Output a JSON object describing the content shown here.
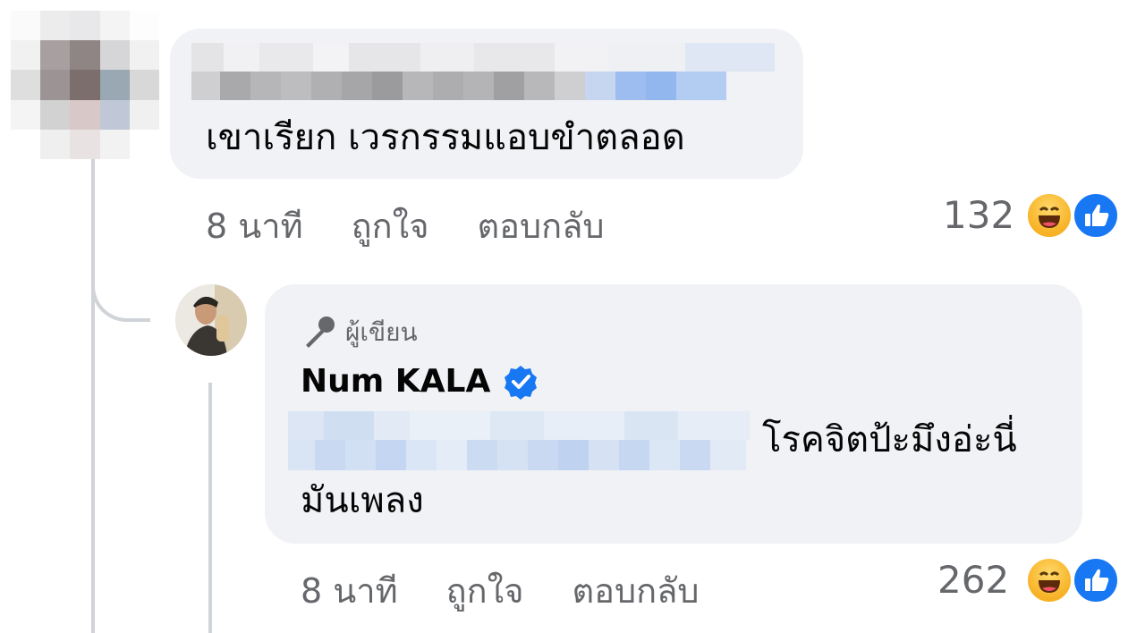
{
  "comment1": {
    "text": "เขาเรียก เวรกรรมแอบขำตลอด",
    "time": "8 นาที",
    "like_label": "ถูกใจ",
    "reply_label": "ตอบกลับ",
    "reaction_count": "132",
    "reactions": [
      "haha-icon",
      "like-icon"
    ]
  },
  "reply1": {
    "author_badge": "ผู้เขียน",
    "author_name": "Num KALA",
    "verified": true,
    "text_line1": "โรคจิตป้ะมึงอ่ะนี่",
    "text_line2": "มันเพลง",
    "time": "8 นาที",
    "like_label": "ถูกใจ",
    "reply_label": "ตอบกลับ",
    "reaction_count": "262",
    "reactions": [
      "haha-icon",
      "like-icon"
    ]
  },
  "colors": {
    "bubble": "#f0f2f5",
    "meta_text": "#65676b",
    "like_blue": "#1877f2",
    "verified_blue": "#1877f2",
    "haha_yellow": "#f7b125"
  }
}
